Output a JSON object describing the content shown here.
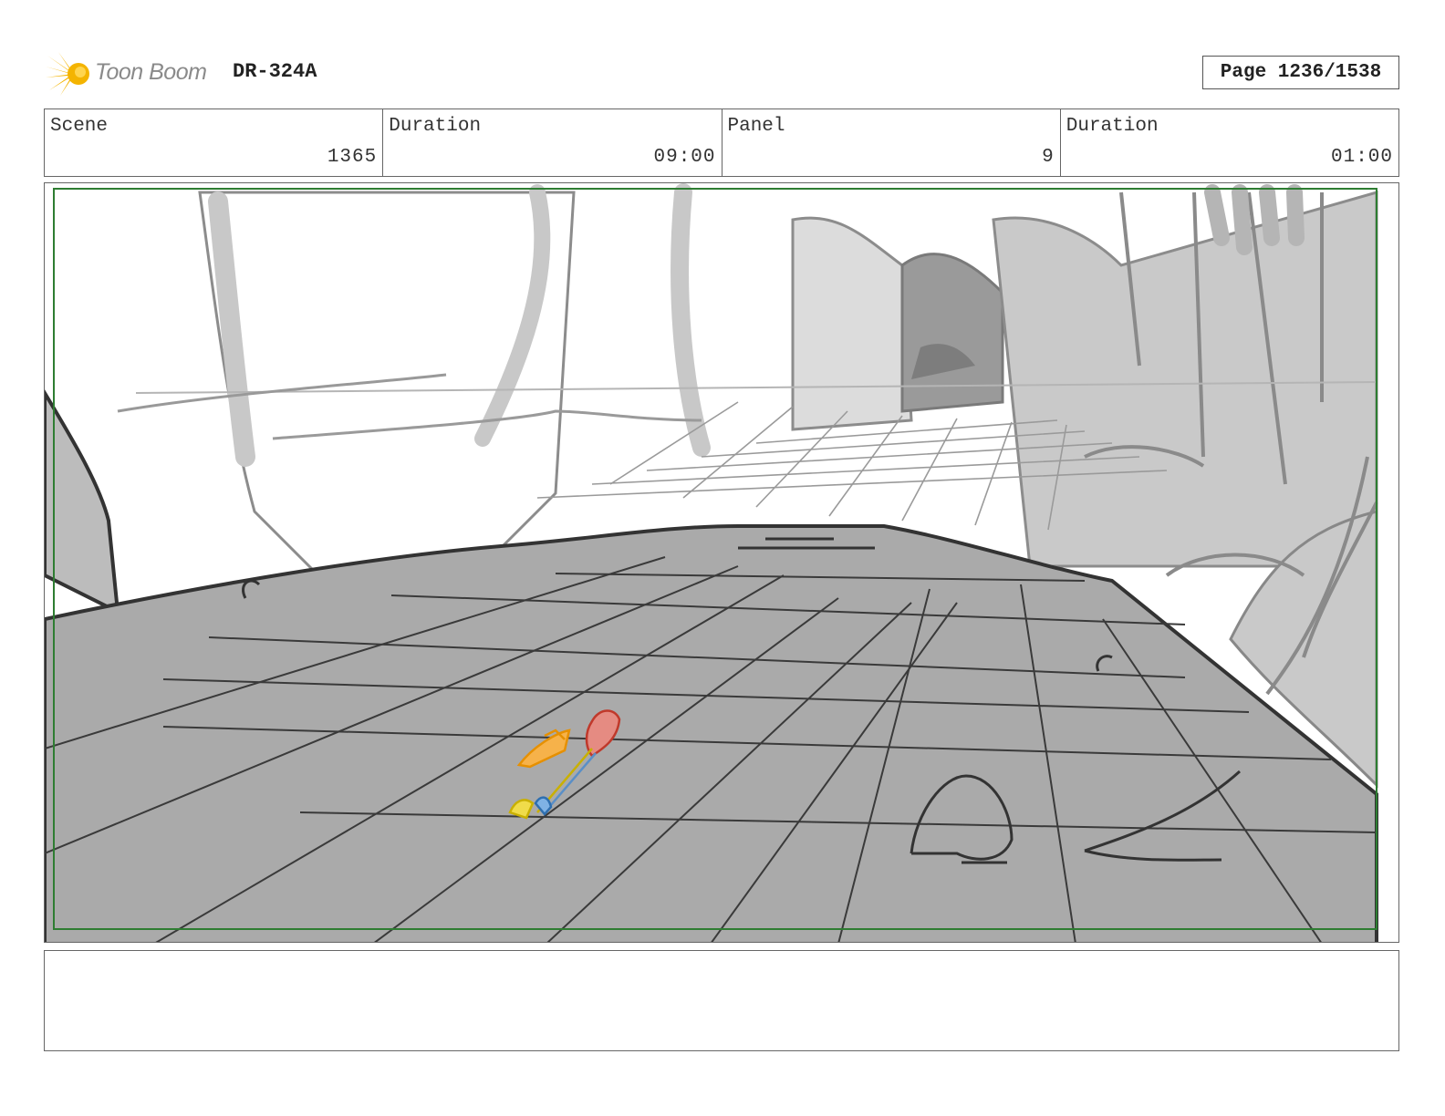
{
  "header": {
    "logo_text": "Toon Boom",
    "project_code": "DR-324A",
    "page_label": "Page 1236/1538"
  },
  "info": {
    "scene_label": "Scene",
    "scene_value": "1365",
    "scene_duration_label": "Duration",
    "scene_duration_value": "09:00",
    "panel_label": "Panel",
    "panel_value": "9",
    "panel_duration_label": "Duration",
    "panel_duration_value": "01:00"
  },
  "colors": {
    "safe_frame": "#2e7d32",
    "ground": "#aaaaaa",
    "cliffs": "#c9c9c9",
    "logo_accent": "#f4b400"
  },
  "notes": ""
}
